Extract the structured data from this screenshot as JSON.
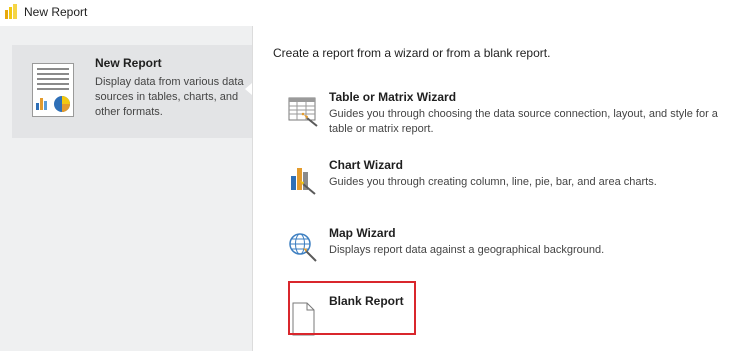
{
  "window": {
    "title": "New Report",
    "icon": "report-builder-app-icon"
  },
  "sidebar": {
    "items": [
      {
        "title": "New Report",
        "description": "Display data from various data sources in tables, charts, and other formats.",
        "icon": "report-document-icon",
        "selected": true
      }
    ]
  },
  "main": {
    "intro": "Create a report from a wizard or from a blank report.",
    "options": [
      {
        "title": "Table or Matrix Wizard",
        "description": "Guides you through choosing the data source connection, layout, and style for a table or matrix report.",
        "icon": "table-wizard-icon"
      },
      {
        "title": "Chart Wizard",
        "description": "Guides you through creating column, line, pie, bar, and area charts.",
        "icon": "chart-wizard-icon"
      },
      {
        "title": "Map Wizard",
        "description": "Displays report data against a geographical background.",
        "icon": "map-wizard-icon"
      },
      {
        "title": "Blank Report",
        "description": "",
        "icon": "blank-page-icon",
        "highlighted": true
      }
    ]
  },
  "colors": {
    "sidebar_bg": "#eff0f1",
    "selected_bg": "#e3e4e6",
    "highlight_border": "#d9262c",
    "app_icon": "#f2c811"
  }
}
